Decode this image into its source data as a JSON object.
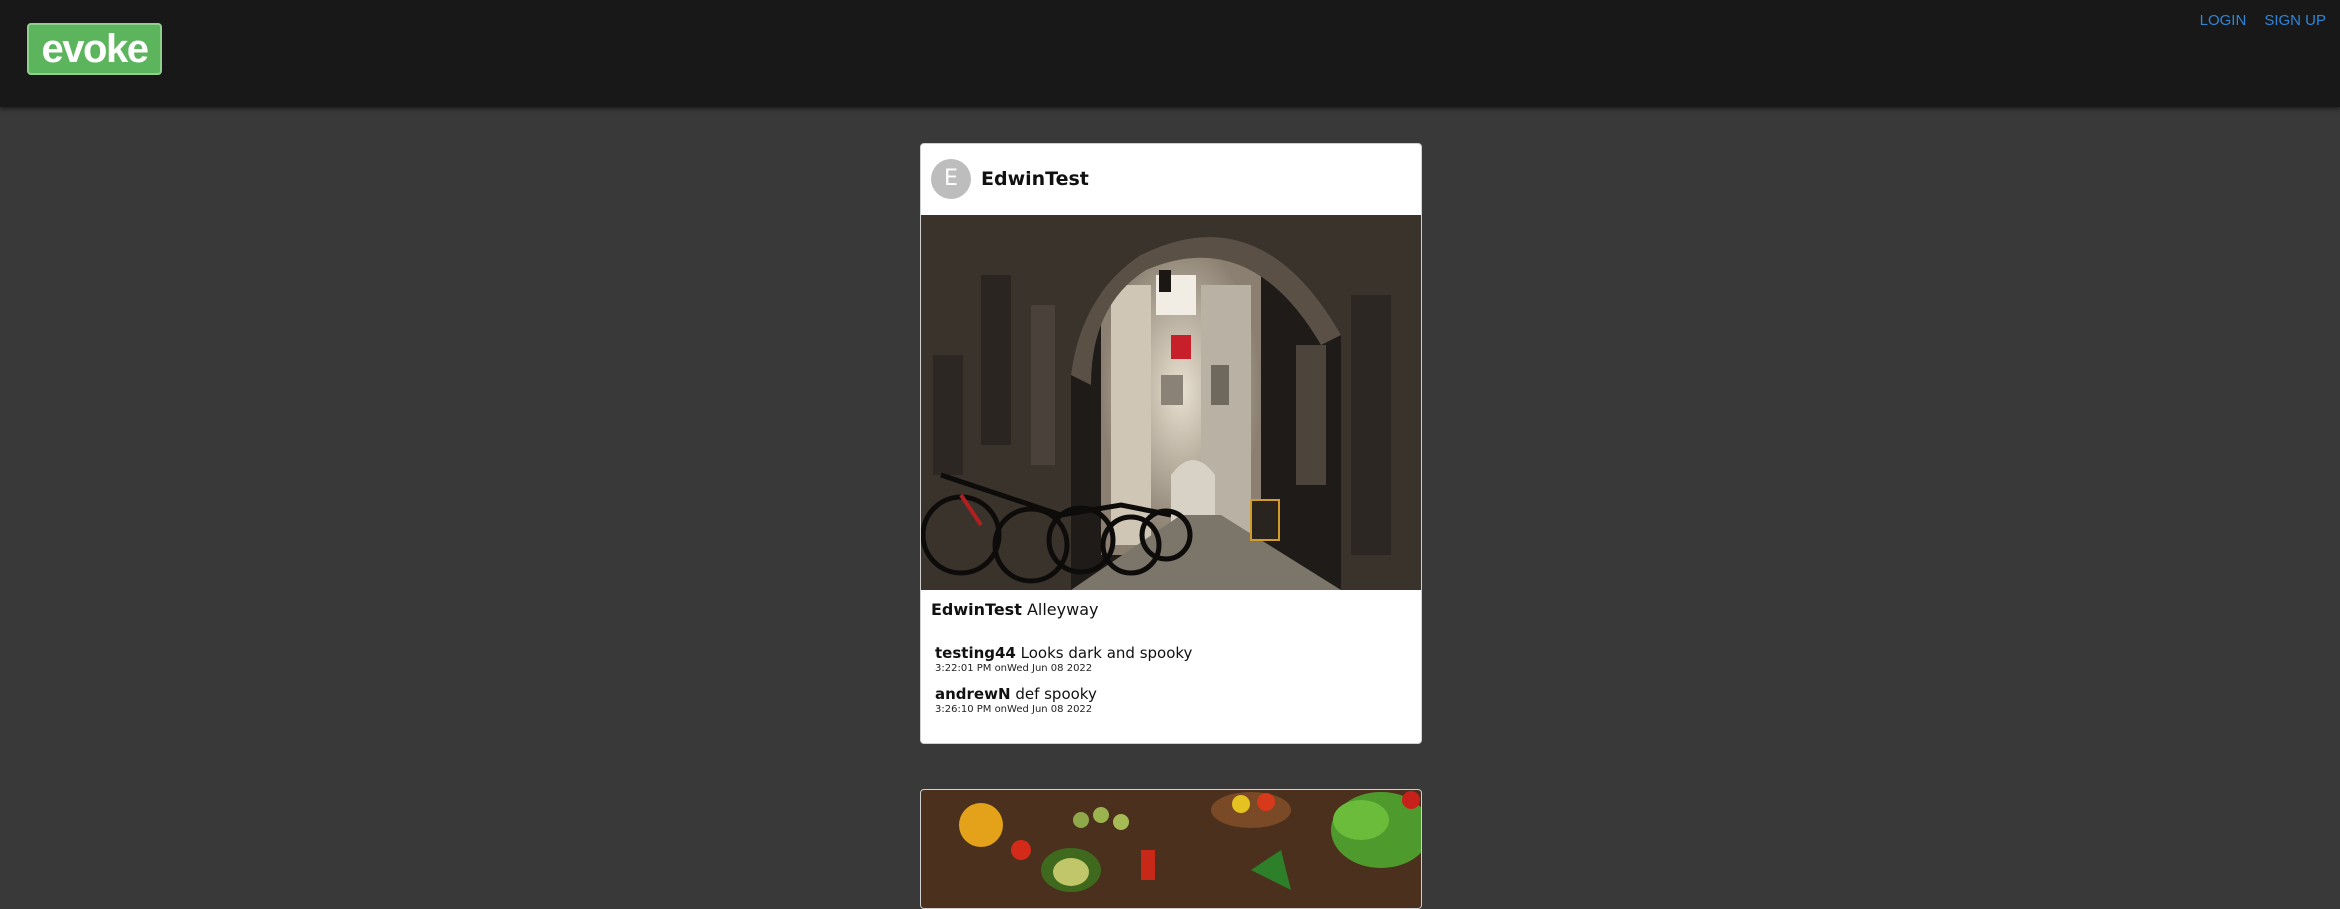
{
  "header": {
    "logo_text": "evoke",
    "nav": {
      "login": "LOGIN",
      "signup": "SIGN UP"
    },
    "colors": {
      "bar": "#181818",
      "logo": "#5cb45c",
      "link": "#2f86d8"
    }
  },
  "posts": [
    {
      "avatar_letter": "E",
      "author": "EdwinTest",
      "image": "alleyway-photo",
      "caption_author": "EdwinTest",
      "caption_text": "Alleyway",
      "comments": [
        {
          "user": "testing44",
          "text": "Looks dark and spooky",
          "time": "3:22:01 PM onWed Jun 08 2022"
        },
        {
          "user": "andrewN",
          "text": "def spooky",
          "time": "3:26:10 PM onWed Jun 08 2022"
        }
      ]
    },
    {
      "image": "vegetables-photo"
    }
  ]
}
